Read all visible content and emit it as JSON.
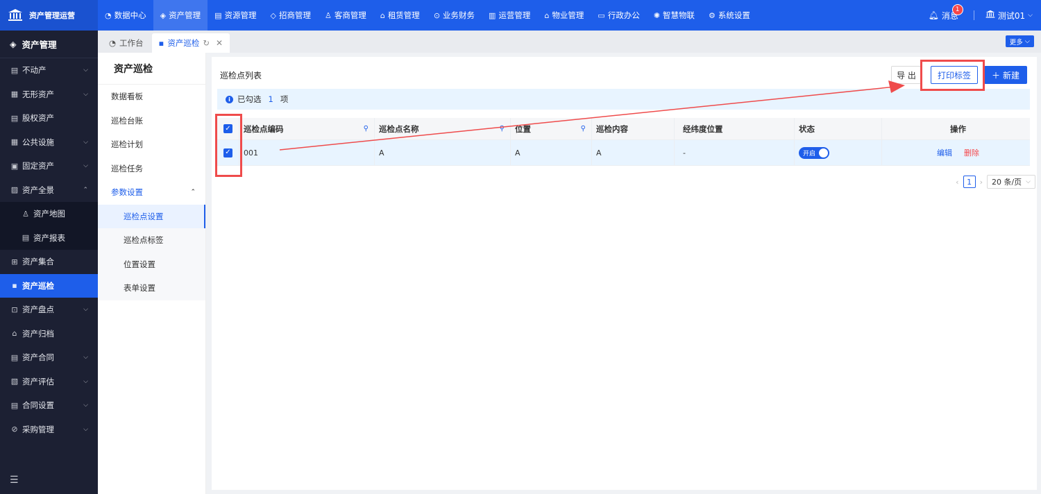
{
  "brand": {
    "title": "资产管理运营",
    "logo_icon": "bank-icon"
  },
  "topnav": [
    {
      "label": "数据中心",
      "icon": "dashboard-icon"
    },
    {
      "label": "资产管理",
      "icon": "cube-icon",
      "active": true
    },
    {
      "label": "资源管理",
      "icon": "building-icon"
    },
    {
      "label": "招商管理",
      "icon": "tag-icon"
    },
    {
      "label": "客商管理",
      "icon": "users-icon"
    },
    {
      "label": "租赁管理",
      "icon": "home-icon"
    },
    {
      "label": "业务财务",
      "icon": "coin-icon"
    },
    {
      "label": "运营管理",
      "icon": "chart-icon"
    },
    {
      "label": "物业管理",
      "icon": "house-icon"
    },
    {
      "label": "行政办公",
      "icon": "monitor-icon"
    },
    {
      "label": "智慧物联",
      "icon": "iot-icon"
    },
    {
      "label": "系统设置",
      "icon": "gear-icon"
    }
  ],
  "header": {
    "messages_label": "消息",
    "messages_count": "1",
    "user_name": "测试01"
  },
  "sidebar": {
    "title": "资产管理",
    "items": [
      {
        "label": "不动产",
        "icon": "building-icon",
        "chevron": "down"
      },
      {
        "label": "无形资产",
        "icon": "doc-icon",
        "chevron": "down"
      },
      {
        "label": "股权资产",
        "icon": "ledger-icon",
        "chevron": ""
      },
      {
        "label": "公共设施",
        "icon": "facility-icon",
        "chevron": "down"
      },
      {
        "label": "固定资产",
        "icon": "asset-icon",
        "chevron": "down"
      },
      {
        "label": "资产全景",
        "icon": "panorama-icon",
        "chevron": "up"
      },
      {
        "label": "资产地图",
        "icon": "map-pin-icon",
        "sub": true
      },
      {
        "label": "资产报表",
        "icon": "report-icon",
        "sub": true
      },
      {
        "label": "资产集合",
        "icon": "grid-icon",
        "chevron": ""
      },
      {
        "label": "资产巡检",
        "icon": "inspect-icon",
        "active": true
      },
      {
        "label": "资产盘点",
        "icon": "count-icon",
        "chevron": "down"
      },
      {
        "label": "资产归档",
        "icon": "archive-icon",
        "chevron": ""
      },
      {
        "label": "资产合同",
        "icon": "contract-icon",
        "chevron": "down"
      },
      {
        "label": "资产评估",
        "icon": "evaluate-icon",
        "chevron": "down"
      },
      {
        "label": "合同设置",
        "icon": "settings-doc-icon",
        "chevron": "down"
      },
      {
        "label": "采购管理",
        "icon": "purchase-icon",
        "chevron": "down"
      }
    ]
  },
  "tabs": [
    {
      "label": "工作台",
      "icon": "home-icon"
    },
    {
      "label": "资产巡检",
      "icon": "inspect-icon",
      "active": true
    }
  ],
  "more_label": "更多",
  "submenu": {
    "title": "资产巡检",
    "items": [
      {
        "label": "数据看板",
        "type": "item"
      },
      {
        "label": "巡检台账",
        "type": "item"
      },
      {
        "label": "巡检计划",
        "type": "item"
      },
      {
        "label": "巡检任务",
        "type": "item"
      },
      {
        "label": "参数设置",
        "type": "group"
      },
      {
        "label": "巡检点设置",
        "type": "child",
        "selected": true
      },
      {
        "label": "巡检点标签",
        "type": "child"
      },
      {
        "label": "位置设置",
        "type": "child"
      },
      {
        "label": "表单设置",
        "type": "child"
      }
    ]
  },
  "main": {
    "list_title": "巡检点列表",
    "export_label": "导 出",
    "print_label": "打印标签",
    "new_label": "新建",
    "selection": {
      "prefix": "已勾选",
      "count": "1",
      "suffix": "项"
    },
    "columns": [
      "巡检点编码",
      "巡检点名称",
      "位置",
      "巡检内容",
      "经纬度位置",
      "状态",
      "操作"
    ],
    "rows": [
      {
        "code": "001",
        "name": "A",
        "position": "A",
        "content": "A",
        "geo": "-",
        "status": "开启",
        "edit": "编辑",
        "delete": "删除"
      }
    ],
    "pagination": {
      "current": "1",
      "page_size": "20 条/页"
    }
  },
  "colors": {
    "primary": "#1e5eea",
    "sidebar": "#1c2033",
    "danger": "#f5464a",
    "annotation": "#ef4b4b"
  }
}
